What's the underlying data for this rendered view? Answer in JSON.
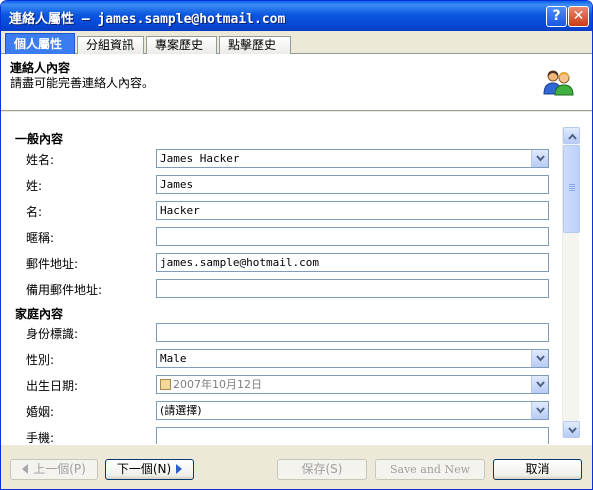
{
  "window": {
    "title": "連絡人屬性 — james.sample@hotmail.com",
    "help_glyph": "?",
    "close_glyph": "✕"
  },
  "tabs": [
    {
      "label": "個人屬性",
      "active": true
    },
    {
      "label": "分組資訊",
      "active": false
    },
    {
      "label": "專案歷史",
      "active": false
    },
    {
      "label": "點擊歷史",
      "active": false
    }
  ],
  "header": {
    "title": "連絡人內容",
    "subtitle": "請盡可能完善連絡人內容。",
    "icon": "contacts-people-icon"
  },
  "sections": {
    "general": "一般內容",
    "family": "家庭內容"
  },
  "fields": {
    "fullname": {
      "label": "姓名:",
      "value": "James Hacker",
      "type": "combo"
    },
    "lastname": {
      "label": "姓:",
      "value": "James",
      "type": "text"
    },
    "firstname": {
      "label": "名:",
      "value": "Hacker",
      "type": "text"
    },
    "nickname": {
      "label": "暱稱:",
      "value": "",
      "type": "text"
    },
    "email": {
      "label": "郵件地址:",
      "value": "james.sample@hotmail.com",
      "type": "text"
    },
    "alt_email": {
      "label": "備用郵件地址:",
      "value": "",
      "type": "text"
    },
    "id_number": {
      "label": "身份標識:",
      "value": "",
      "type": "text"
    },
    "gender": {
      "label": "性別:",
      "value": "Male",
      "type": "combo"
    },
    "birthdate": {
      "label": "出生日期:",
      "value": "2007年10月12日",
      "type": "date"
    },
    "marital": {
      "label": "婚姻:",
      "value": "(請選擇)",
      "type": "combo"
    },
    "mobile": {
      "label": "手機:",
      "value": "",
      "type": "text"
    }
  },
  "footer": {
    "prev_label": "上一個(P)",
    "next_label": "下一個(N)",
    "save_label": "保存(S)",
    "save_new_label": "Save and New",
    "cancel_label": "取消"
  },
  "colors": {
    "titlebar": "#0B58E0",
    "active_tab": "#3B7DF0",
    "field_border": "#7F9DB9",
    "dialog_bg": "#ECE9D8"
  }
}
